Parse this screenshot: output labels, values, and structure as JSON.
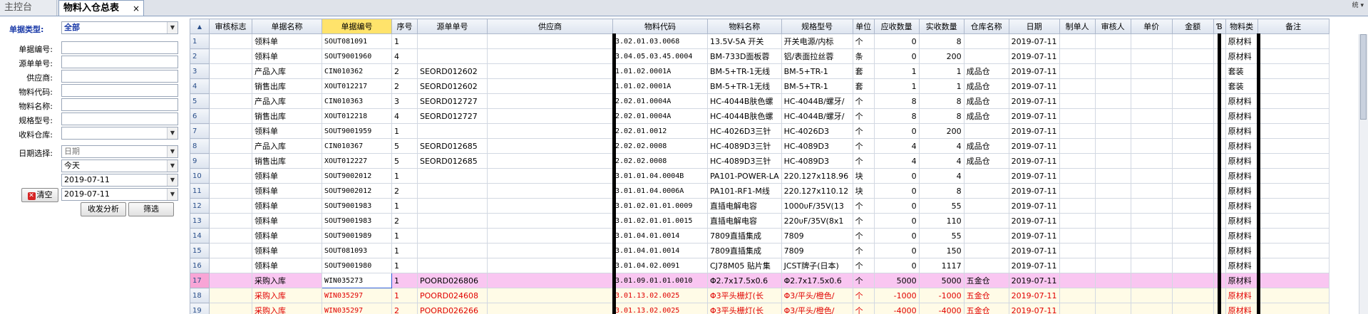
{
  "tabs": [
    {
      "label": "主控台"
    },
    {
      "label": "物料入仓总表",
      "close": "×"
    }
  ],
  "corner_text": "统 ▾",
  "filters": {
    "doc_type_label": "单据类型:",
    "doc_type_value": "全部",
    "doc_no_label": "单据编号:",
    "source_no_label": "源单单号:",
    "supplier_label": "供应商:",
    "material_code_label": "物料代码:",
    "material_name_label": "物料名称:",
    "spec_label": "规格型号:",
    "warehouse_label": "收料仓库:",
    "date_select_label": "日期选择:",
    "date_type_value": "日期",
    "date_range_value": "今天",
    "date_from": "2019-07-11",
    "date_to": "2019-07-11",
    "clear_label": "清空",
    "analyze_label": "收发分析",
    "filter_label": "筛选"
  },
  "grid": {
    "corner_icon": "▲",
    "columns": [
      "审核标志",
      "单据名称",
      "单据编号",
      "序号",
      "源单单号",
      "供应商",
      "物料代码",
      "物料名称",
      "规格型号",
      "单位",
      "应收数量",
      "实收数量",
      "仓库名称",
      "日期",
      "制单人",
      "审核人",
      "单价",
      "金额",
      "Ɓ",
      "物料类",
      "备注"
    ],
    "rows": [
      [
        "1",
        "",
        "领料单",
        "SOUT081091",
        "1",
        "",
        "",
        "3.02.01.03.0068",
        "13.5V-5A 开关",
        "开关电源/内标",
        "个",
        "0",
        "8",
        "",
        "2019-07-11",
        "",
        "",
        "",
        "",
        "",
        "原材料",
        ""
      ],
      [
        "2",
        "",
        "领料单",
        "SOUT9001960",
        "4",
        "",
        "",
        "3.04.05.03.45.0004",
        "BM-733D面板蓉",
        "铝/表面拉丝蓉",
        "条",
        "0",
        "200",
        "",
        "2019-07-11",
        "",
        "",
        "",
        "",
        "",
        "原材料",
        ""
      ],
      [
        "3",
        "",
        "产品入库",
        "CIN010362",
        "2",
        "SEORD012602",
        "",
        "1.01.02.0001A",
        "BM-5+TR-1无线",
        "BM-5+TR-1",
        "套",
        "1",
        "1",
        "成品仓",
        "2019-07-11",
        "",
        "",
        "",
        "",
        "",
        "套装",
        ""
      ],
      [
        "4",
        "",
        "销售出库",
        "XOUT012217",
        "2",
        "SEORD012602",
        "",
        "1.01.02.0001A",
        "BM-5+TR-1无线",
        "BM-5+TR-1",
        "套",
        "1",
        "1",
        "成品仓",
        "2019-07-11",
        "",
        "",
        "",
        "",
        "",
        "套装",
        ""
      ],
      [
        "5",
        "",
        "产品入库",
        "CIN010363",
        "3",
        "SEORD012727",
        "",
        "2.02.01.0004A",
        "HC-4044B肤色螺",
        "HC-4044B/螺牙/",
        "个",
        "8",
        "8",
        "成品仓",
        "2019-07-11",
        "",
        "",
        "",
        "",
        "",
        "原材料",
        ""
      ],
      [
        "6",
        "",
        "销售出库",
        "XOUT012218",
        "4",
        "SEORD012727",
        "",
        "2.02.01.0004A",
        "HC-4044B肤色螺",
        "HC-4044B/螺牙/",
        "个",
        "8",
        "8",
        "成品仓",
        "2019-07-11",
        "",
        "",
        "",
        "",
        "",
        "原材料",
        ""
      ],
      [
        "7",
        "",
        "领料单",
        "SOUT9001959",
        "1",
        "",
        "",
        "2.02.01.0012",
        "HC-4026D3三针",
        "HC-4026D3",
        "个",
        "0",
        "200",
        "",
        "2019-07-11",
        "",
        "",
        "",
        "",
        "",
        "原材料",
        ""
      ],
      [
        "8",
        "",
        "产品入库",
        "CIN010367",
        "5",
        "SEORD012685",
        "",
        "2.02.02.0008",
        "HC-4089D3三针",
        "HC-4089D3",
        "个",
        "4",
        "4",
        "成品仓",
        "2019-07-11",
        "",
        "",
        "",
        "",
        "",
        "原材料",
        ""
      ],
      [
        "9",
        "",
        "销售出库",
        "XOUT012227",
        "5",
        "SEORD012685",
        "",
        "2.02.02.0008",
        "HC-4089D3三针",
        "HC-4089D3",
        "个",
        "4",
        "4",
        "成品仓",
        "2019-07-11",
        "",
        "",
        "",
        "",
        "",
        "原材料",
        ""
      ],
      [
        "10",
        "",
        "领料单",
        "SOUT9002012",
        "1",
        "",
        "",
        "3.01.01.04.0004B",
        "PA101-POWER-LA",
        "220.127x118.96",
        "块",
        "0",
        "4",
        "",
        "2019-07-11",
        "",
        "",
        "",
        "",
        "",
        "原材料",
        ""
      ],
      [
        "11",
        "",
        "领料单",
        "SOUT9002012",
        "2",
        "",
        "",
        "3.01.01.04.0006A",
        "PA101-RF1-M线",
        "220.127x110.12",
        "块",
        "0",
        "8",
        "",
        "2019-07-11",
        "",
        "",
        "",
        "",
        "",
        "原材料",
        ""
      ],
      [
        "12",
        "",
        "领料单",
        "SOUT9001983",
        "1",
        "",
        "",
        "3.01.02.01.01.0009",
        "直插电解电容",
        "1000υF/35V(13",
        "个",
        "0",
        "55",
        "",
        "2019-07-11",
        "",
        "",
        "",
        "",
        "",
        "原材料",
        ""
      ],
      [
        "13",
        "",
        "领料单",
        "SOUT9001983",
        "2",
        "",
        "",
        "3.01.02.01.01.0015",
        "直插电解电容",
        "220υF/35V(8x1",
        "个",
        "0",
        "110",
        "",
        "2019-07-11",
        "",
        "",
        "",
        "",
        "",
        "原材料",
        ""
      ],
      [
        "14",
        "",
        "领料单",
        "SOUT9001989",
        "1",
        "",
        "",
        "3.01.04.01.0014",
        "7809直插集成",
        "7809",
        "个",
        "0",
        "55",
        "",
        "2019-07-11",
        "",
        "",
        "",
        "",
        "",
        "原材料",
        ""
      ],
      [
        "15",
        "",
        "领料单",
        "SOUT081093",
        "1",
        "",
        "",
        "3.01.04.01.0014",
        "7809直插集成",
        "7809",
        "个",
        "0",
        "150",
        "",
        "2019-07-11",
        "",
        "",
        "",
        "",
        "",
        "原材料",
        ""
      ],
      [
        "16",
        "",
        "领料单",
        "SOUT9001980",
        "1",
        "",
        "",
        "3.01.04.02.0091",
        "CJ78M05 贴片集",
        "JCST牌子(日本)",
        "个",
        "0",
        "1117",
        "",
        "2019-07-11",
        "",
        "",
        "",
        "",
        "",
        "原材料",
        ""
      ],
      [
        "17",
        "",
        "采购入库",
        "WIN035273",
        "1",
        "POORD026806",
        "",
        "3.01.09.01.01.0010",
        "Φ2.7x17.5x0.6",
        "Φ2.7x17.5x0.6",
        "个",
        "5000",
        "5000",
        "五金仓",
        "2019-07-11",
        "",
        "",
        "",
        "",
        "",
        "原材料",
        ""
      ],
      [
        "18",
        "",
        "采购入库",
        "WIN035297",
        "1",
        "POORD024608",
        "",
        "3.01.13.02.0025",
        "Φ3平头栅灯(长",
        "Φ3/平头/橙色/",
        "个",
        "-1000",
        "-1000",
        "五金仓",
        "2019-07-11",
        "",
        "",
        "",
        "",
        "",
        "原材料",
        ""
      ],
      [
        "19",
        "",
        "采购入库",
        "WIN035297",
        "2",
        "POORD026266",
        "",
        "3.01.13.02.0025",
        "Φ3平头栅灯(长",
        "Φ3/平头/橙色/",
        "个",
        "-4000",
        "-4000",
        "五金仓",
        "2019-07-11",
        "",
        "",
        "",
        "",
        "",
        "原材料",
        ""
      ]
    ]
  }
}
